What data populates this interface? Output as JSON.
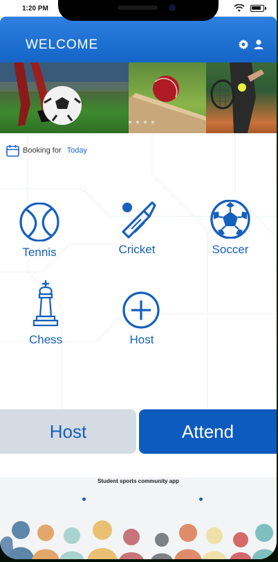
{
  "status_bar": {
    "time": "1:20 PM"
  },
  "header": {
    "title": "WELCOME",
    "icons": [
      "gear-icon",
      "user-icon"
    ]
  },
  "booking": {
    "prefix": "Booking for",
    "day": "Today",
    "icon": "calendar-icon"
  },
  "sports": [
    {
      "label": "Tennis",
      "icon": "tennis-ball-icon"
    },
    {
      "label": "Cricket",
      "icon": "cricket-bat-icon"
    },
    {
      "label": "Soccer",
      "icon": "soccer-ball-icon"
    },
    {
      "label": "Chess",
      "icon": "chess-king-icon"
    },
    {
      "label": "Host",
      "icon": "plus-circle-icon"
    }
  ],
  "actions": {
    "host": "Host",
    "attend": "Attend"
  },
  "footer": {
    "tagline": "Student sports community app"
  },
  "colors": {
    "primary": "#1565c8",
    "accent_blue": "#1560bd",
    "host_bg": "#d5dbe2",
    "attend_bg": "#0d5bbf"
  }
}
